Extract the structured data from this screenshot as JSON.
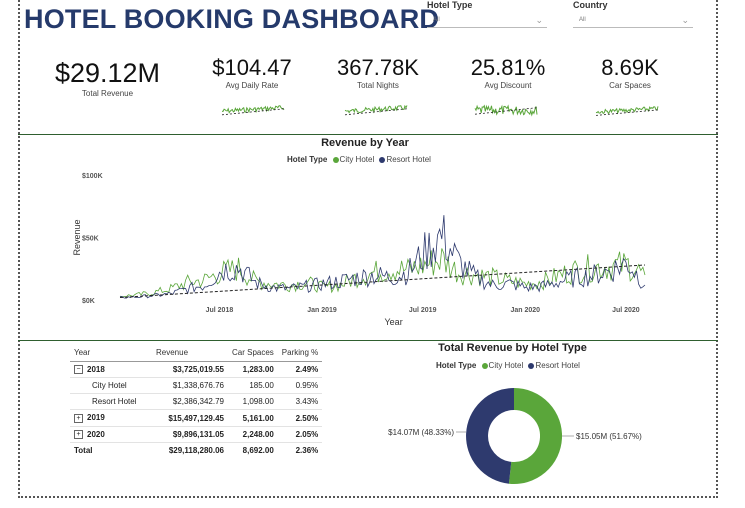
{
  "header": {
    "title": "HOTEL BOOKING DASHBOARD"
  },
  "slicers": [
    {
      "label": "Hotel Type",
      "value": "All"
    },
    {
      "label": "Country",
      "value": "All"
    }
  ],
  "kpis": {
    "main": {
      "value": "$29.12M",
      "label": "Total Revenue"
    },
    "cards": [
      {
        "value": "$104.47",
        "label": "Avg Daily Rate"
      },
      {
        "value": "367.78K",
        "label": "Total Nights"
      },
      {
        "value": "25.81%",
        "label": "Avg Discount"
      },
      {
        "value": "8.69K",
        "label": "Car Spaces"
      }
    ]
  },
  "colors": {
    "city": "#5aa63a",
    "resort": "#2e3a6e",
    "title": "#253a6b",
    "divider": "#2f5f2f"
  },
  "legend": {
    "prefix": "Hotel Type",
    "city": "City Hotel",
    "resort": "Resort Hotel"
  },
  "chart_data": [
    {
      "type": "line",
      "title": "Revenue by Year",
      "xlabel": "Year",
      "ylabel": "Revenue",
      "yticks": [
        "$0K",
        "$50K",
        "$100K"
      ],
      "xticks": [
        "Jul 2018",
        "Jan 2019",
        "Jul 2019",
        "Jan 2020",
        "Jul 2020"
      ],
      "ylim": [
        0,
        100000
      ],
      "x": [
        "2018-01",
        "2018-02",
        "2018-03",
        "2018-04",
        "2018-05",
        "2018-06",
        "2018-07",
        "2018-08",
        "2018-09",
        "2018-10",
        "2018-11",
        "2018-12",
        "2019-01",
        "2019-02",
        "2019-03",
        "2019-04",
        "2019-05",
        "2019-06",
        "2019-07",
        "2019-08",
        "2019-09",
        "2019-10",
        "2019-11",
        "2019-12",
        "2020-01",
        "2020-02",
        "2020-03",
        "2020-04",
        "2020-05",
        "2020-06",
        "2020-07",
        "2020-08"
      ],
      "series": [
        {
          "name": "City Hotel",
          "color": "#5aa63a",
          "values": [
            3000,
            4000,
            6000,
            9000,
            14000,
            16000,
            22000,
            25000,
            15000,
            13000,
            12000,
            14000,
            10000,
            12000,
            18000,
            22000,
            25000,
            24000,
            28000,
            33000,
            22000,
            20000,
            18000,
            15000,
            13000,
            15000,
            20000,
            24000,
            26000,
            27000,
            28000,
            20000
          ]
        },
        {
          "name": "Resort Hotel",
          "color": "#2e3a6e",
          "values": [
            2000,
            2500,
            3500,
            5000,
            9000,
            12000,
            24000,
            26000,
            14000,
            10000,
            9000,
            11000,
            13000,
            15000,
            18000,
            20000,
            18000,
            22000,
            38000,
            52000,
            30000,
            18000,
            12000,
            13000,
            10000,
            11000,
            15000,
            18000,
            20000,
            24000,
            30000,
            12000
          ]
        }
      ],
      "trend": [
        2000,
        28000
      ]
    },
    {
      "type": "pie",
      "title": "Total Revenue by Hotel Type",
      "slices": [
        {
          "name": "City Hotel",
          "value": 15.05,
          "label": "$15.05M (51.67%)",
          "color": "#5aa63a"
        },
        {
          "name": "Resort Hotel",
          "value": 14.07,
          "label": "$14.07M (48.33%)",
          "color": "#2e3a6e"
        }
      ]
    }
  ],
  "table": {
    "headers": [
      "Year",
      "Revenue",
      "Car Spaces",
      "Parking %"
    ],
    "rows": [
      {
        "label": "2018",
        "cells": [
          "$3,725,019.55",
          "1,283.00",
          "2.49%"
        ]
      },
      {
        "label": "City Hotel",
        "cells": [
          "$1,338,676.76",
          "185.00",
          "0.95%"
        ]
      },
      {
        "label": "Resort Hotel",
        "cells": [
          "$2,386,342.79",
          "1,098.00",
          "3.43%"
        ]
      },
      {
        "label": "2019",
        "cells": [
          "$15,497,129.45",
          "5,161.00",
          "2.50%"
        ]
      },
      {
        "label": "2020",
        "cells": [
          "$9,896,131.05",
          "2,248.00",
          "2.05%"
        ]
      },
      {
        "label": "Total",
        "cells": [
          "$29,118,280.06",
          "8,692.00",
          "2.36%"
        ]
      }
    ]
  }
}
